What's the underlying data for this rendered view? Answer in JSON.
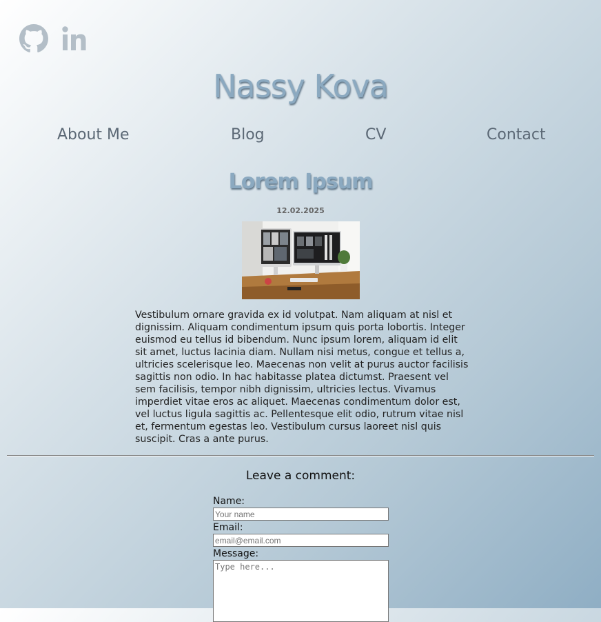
{
  "social": {
    "github_icon": "github-icon",
    "linkedin_icon": "linkedin-icon",
    "linkedin_text": "in"
  },
  "header": {
    "title": "Nassy Kova"
  },
  "nav": {
    "items": [
      {
        "label": "About Me"
      },
      {
        "label": "Blog"
      },
      {
        "label": "CV"
      },
      {
        "label": "Contact"
      }
    ]
  },
  "post": {
    "title": "Lorem Ipsum",
    "date": "12.02.2025",
    "image_alt": "desk with computer monitors",
    "body": "Vestibulum ornare gravida ex id volutpat. Nam aliquam at nisl et dignissim. Aliquam condimentum ipsum quis porta lobortis. Integer euismod eu tellus id bibendum. Nunc ipsum lorem, aliquam id elit sit amet, luctus lacinia diam. Nullam nisi metus, congue et tellus a, ultricies scelerisque leo. Maecenas non velit at purus auctor facilisis sagittis non odio. In hac habitasse platea dictumst. Praesent vel sem facilisis, tempor nibh dignissim, ultricies lectus. Vivamus imperdiet vitae eros ac aliquet. Maecenas condimentum dolor est, vel luctus ligula sagittis ac. Pellentesque elit odio, rutrum vitae nisl et, fermentum egestas leo. Vestibulum cursus laoreet nisl quis suscipit. Cras a ante purus."
  },
  "comments": {
    "heading": "Leave a comment:",
    "name_label": "Name:",
    "name_placeholder": "Your name",
    "email_label": "Email:",
    "email_placeholder": "email@email.com",
    "message_label": "Message:",
    "message_placeholder": "Type here..."
  },
  "colors": {
    "title": "#8ba9c0",
    "nav_text": "#5b6875",
    "icon": "#b5bfc7"
  }
}
